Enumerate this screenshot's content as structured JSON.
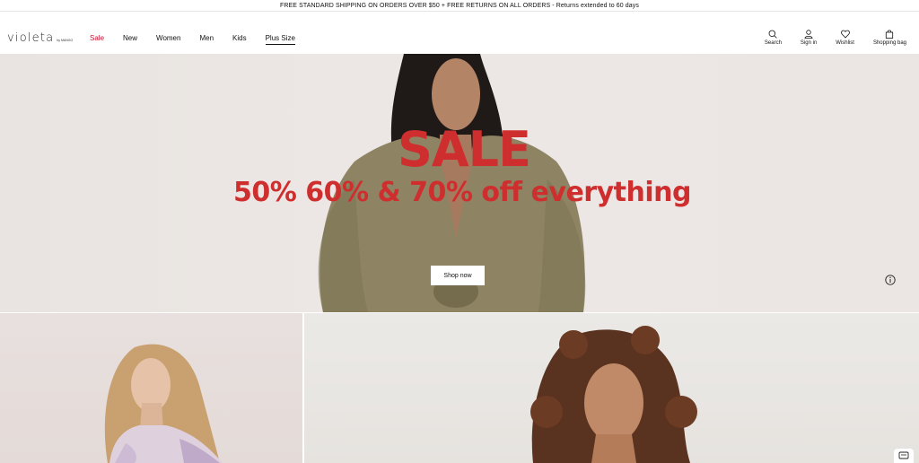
{
  "promo": {
    "text": "FREE STANDARD SHIPPING ON ORDERS OVER $50 + FREE RETURNS ON ALL ORDERS - Returns extended to 60 days"
  },
  "brand": {
    "logo": "violeta",
    "logo_sub": "by MANGO",
    "accent_color": "#cf2e2e"
  },
  "nav": {
    "items": [
      {
        "label": "Sale"
      },
      {
        "label": "New"
      },
      {
        "label": "Women"
      },
      {
        "label": "Men"
      },
      {
        "label": "Kids"
      },
      {
        "label": "Plus Size"
      }
    ]
  },
  "utils": {
    "search": {
      "label": "Search",
      "icon": "search-icon"
    },
    "signin": {
      "label": "Sign in",
      "icon": "user-icon"
    },
    "wishlist": {
      "label": "Wishlist",
      "icon": "heart-icon"
    },
    "bag": {
      "label": "Shopping bag",
      "icon": "bag-icon"
    }
  },
  "hero": {
    "title": "SALE",
    "subtitle": "50% 60% & 70% off everything",
    "cta": "Shop now"
  }
}
